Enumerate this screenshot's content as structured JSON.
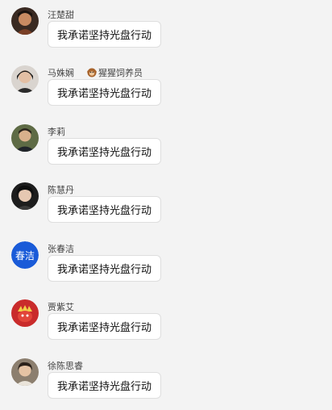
{
  "messages": [
    {
      "sender": "汪楚甜",
      "text": "我承诺坚持光盘行动",
      "avatar": "photo-avatar"
    },
    {
      "sender": "马姝娴",
      "badge": "猩猩饲养员",
      "badge_icon": "monkey-icon",
      "text": "我承诺坚持光盘行动",
      "avatar": "photo-avatar"
    },
    {
      "sender": "李莉",
      "text": "我承诺坚持光盘行动",
      "avatar": "photo-avatar"
    },
    {
      "sender": "陈慧丹",
      "text": "我承诺坚持光盘行动",
      "avatar": "photo-avatar"
    },
    {
      "sender": "张春洁",
      "text": "我承诺坚持光盘行动",
      "avatar": "text-avatar",
      "avatar_text": "春洁",
      "avatar_color": "#1a5bd8"
    },
    {
      "sender": "贾紫艾",
      "text": "我承诺坚持光盘行动",
      "avatar": "photo-avatar"
    },
    {
      "sender": "徐陈思睿",
      "text": "我承诺坚持光盘行动",
      "avatar": "photo-avatar"
    }
  ]
}
